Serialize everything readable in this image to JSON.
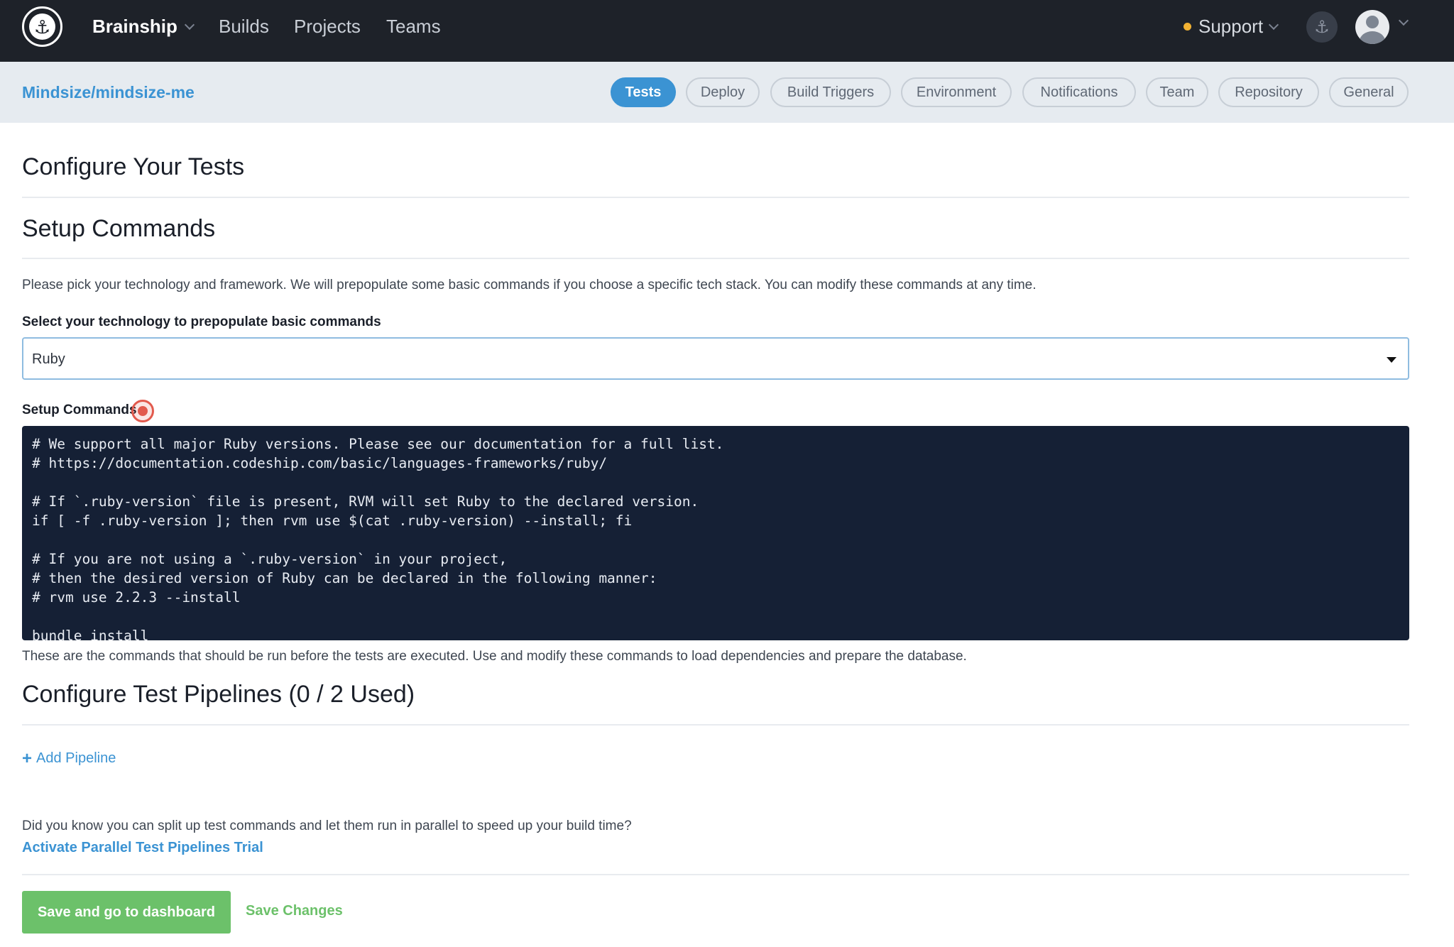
{
  "topbar": {
    "logo_icon": "anchor-ship-logo",
    "brand": "Brainship",
    "nav": [
      "Builds",
      "Projects",
      "Teams"
    ],
    "support": "Support",
    "support_status_color": "#f2b233",
    "anchor_icon": "⚓"
  },
  "subbar": {
    "repo": "Mindsize/mindsize-me",
    "tabs": [
      {
        "label": "Tests",
        "active": true
      },
      {
        "label": "Deploy",
        "active": false
      },
      {
        "label": "Build Triggers",
        "active": false
      },
      {
        "label": "Environment",
        "active": false
      },
      {
        "label": "Notifications",
        "active": false
      },
      {
        "label": "Team",
        "active": false
      },
      {
        "label": "Repository",
        "active": false
      },
      {
        "label": "General",
        "active": false
      }
    ]
  },
  "main": {
    "title": "Configure Your Tests",
    "setup": {
      "heading": "Setup Commands",
      "description": "Please pick your technology and framework. We will prepopulate some basic commands if you choose a specific tech stack. You can modify these commands at any time.",
      "select_label": "Select your technology to prepopulate basic commands",
      "select_value": "Ruby",
      "commands_label": "Setup Commands",
      "commands": [
        "# We support all major Ruby versions. Please see our documentation for a full list.",
        "# https://documentation.codeship.com/basic/languages-frameworks/ruby/",
        "",
        "# If `.ruby-version` file is present, RVM will set Ruby to the declared version.",
        "if [ -f .ruby-version ]; then rvm use $(cat .ruby-version) --install; fi",
        "",
        "# If you are not using a `.ruby-version` in your project,",
        "# then the desired version of Ruby can be declared in the following manner:",
        "# rvm use 2.2.3 --install",
        "",
        "bundle install"
      ],
      "help": "These are the commands that should be run before the tests are executed. Use and modify these commands to load dependencies and prepare the database."
    },
    "pipelines": {
      "heading": "Configure Test Pipelines (0 / 2 Used)",
      "add_label": "Add Pipeline",
      "tip": "Did you know you can split up test commands and let them run in parallel to speed up your build time?",
      "trial_link": "Activate Parallel Test Pipelines Trial"
    },
    "actions": {
      "primary": "Save and go to dashboard",
      "secondary": "Save Changes"
    }
  }
}
